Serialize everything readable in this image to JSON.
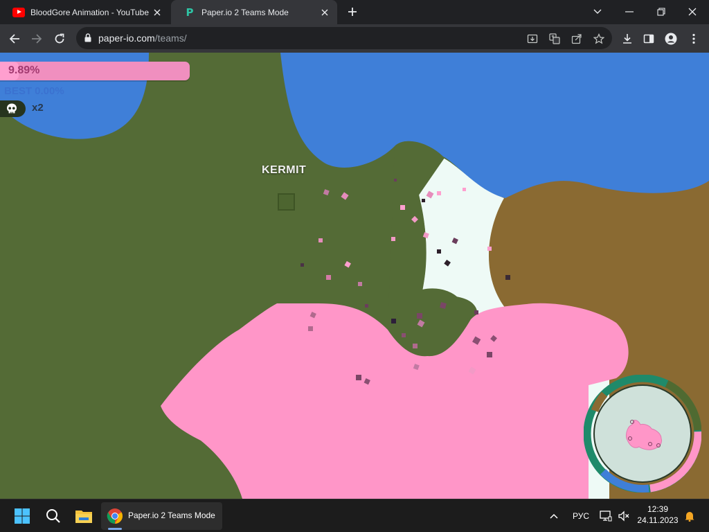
{
  "browser": {
    "tabs": [
      {
        "title": "BloodGore Animation - YouTube",
        "icon": "youtube-icon",
        "active": false
      },
      {
        "title": "Paper.io 2 Teams Mode",
        "icon": "paperio-icon",
        "active": true
      }
    ],
    "url_host": "paper-io.com",
    "url_path": "/teams/"
  },
  "game": {
    "territory_percent": "9.89%",
    "territory_fraction": 0.0989,
    "best": "BEST 0.00%",
    "kills": "x2",
    "player_name": "KERMIT",
    "team_colors": {
      "green": "#546b36",
      "blue": "#3f7fd8",
      "brown": "#8a6a32",
      "pink": "#ff96c8",
      "neutral": "#eefaf6"
    }
  },
  "taskbar": {
    "app_label": "Paper.io 2 Teams Mode",
    "language": "РУС",
    "time": "12:39",
    "date": "24.11.2023"
  }
}
